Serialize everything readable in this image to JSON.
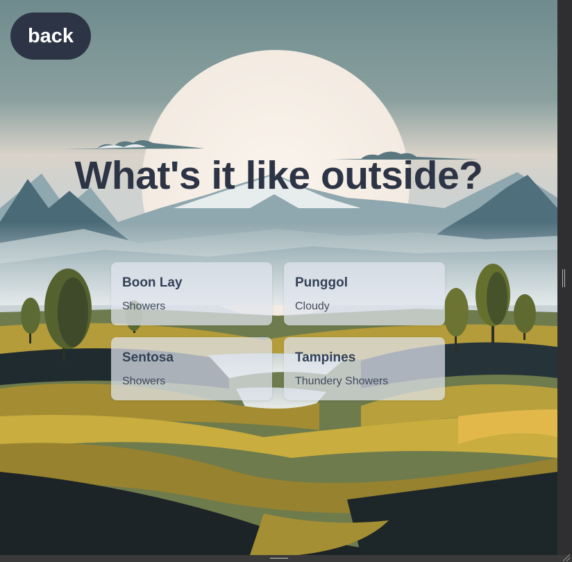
{
  "nav": {
    "back_label": "back"
  },
  "page": {
    "title": "What's it like outside?"
  },
  "locations": [
    {
      "name": "Boon Lay",
      "forecast": "Showers"
    },
    {
      "name": "Punggol",
      "forecast": "Cloudy"
    },
    {
      "name": "Sentosa",
      "forecast": "Showers"
    },
    {
      "name": "Tampines",
      "forecast": "Thundery Showers"
    }
  ],
  "icons": {
    "scrollbar_grip": "grip-lines-icon",
    "resize_handle": "resize-corner-icon"
  },
  "colors": {
    "button_bg": "#2d3446",
    "button_text": "#ffffff",
    "headline": "#2c3445",
    "card_bg": "#e0e5ee",
    "card_title": "#334155",
    "sky_top": "#708c90",
    "sun": "#f6efe6",
    "mountain": "#3f5f6d",
    "hill_gold": "#b39b38",
    "hill_dark": "#1e2a30"
  }
}
